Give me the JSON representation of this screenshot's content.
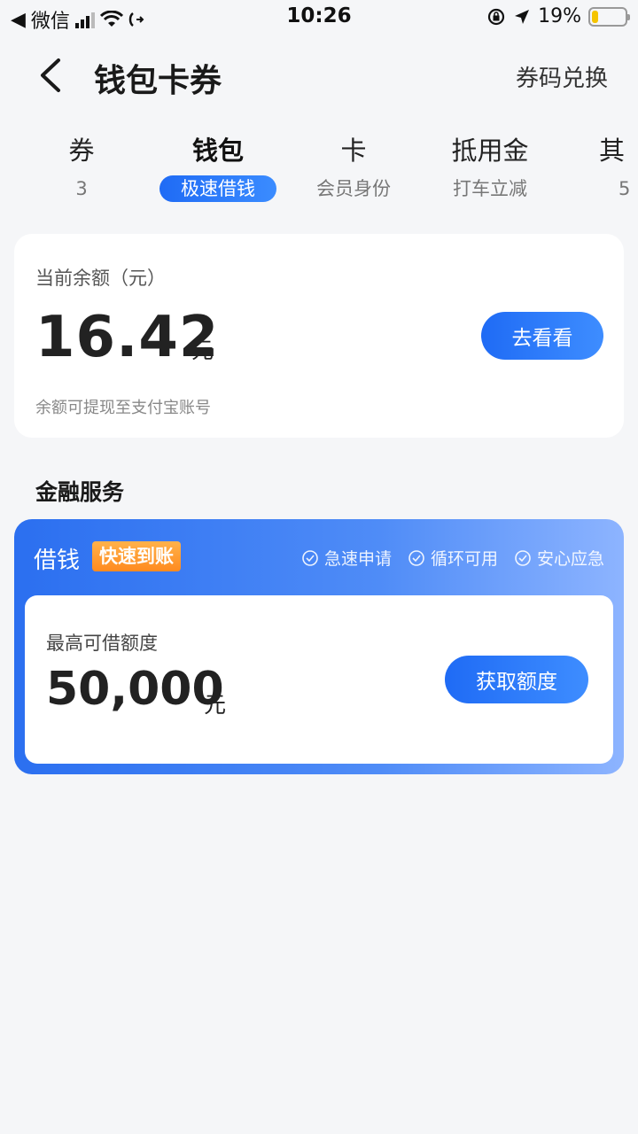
{
  "status_bar": {
    "back_app": "微信",
    "time": "10:26",
    "battery": "19%",
    "battery_level": 0.19
  },
  "nav": {
    "title": "钱包卡券",
    "action": "券码兑换"
  },
  "tabs": [
    {
      "title": "券",
      "sub": "3"
    },
    {
      "title": "钱包",
      "sub": "极速借钱"
    },
    {
      "title": "卡",
      "sub": "会员身份"
    },
    {
      "title": "抵用金",
      "sub": "打车立减"
    },
    {
      "title": "其",
      "sub": "5"
    }
  ],
  "balance": {
    "label": "当前余额（元）",
    "amount": "16.42",
    "unit": "元",
    "note": "余额可提现至支付宝账号",
    "button": "去看看"
  },
  "finance": {
    "section_title": "金融服务",
    "loan_title": "借钱",
    "badge": "快速到账",
    "features": [
      "急速申请",
      "循环可用",
      "安心应急"
    ],
    "limit_label": "最高可借额度",
    "limit_amount": "50,000",
    "limit_unit": "元",
    "button": "获取额度"
  },
  "colors": {
    "accent": "#1f6bf5",
    "badge": "#ff9a2e",
    "background": "#f5f6f8"
  }
}
